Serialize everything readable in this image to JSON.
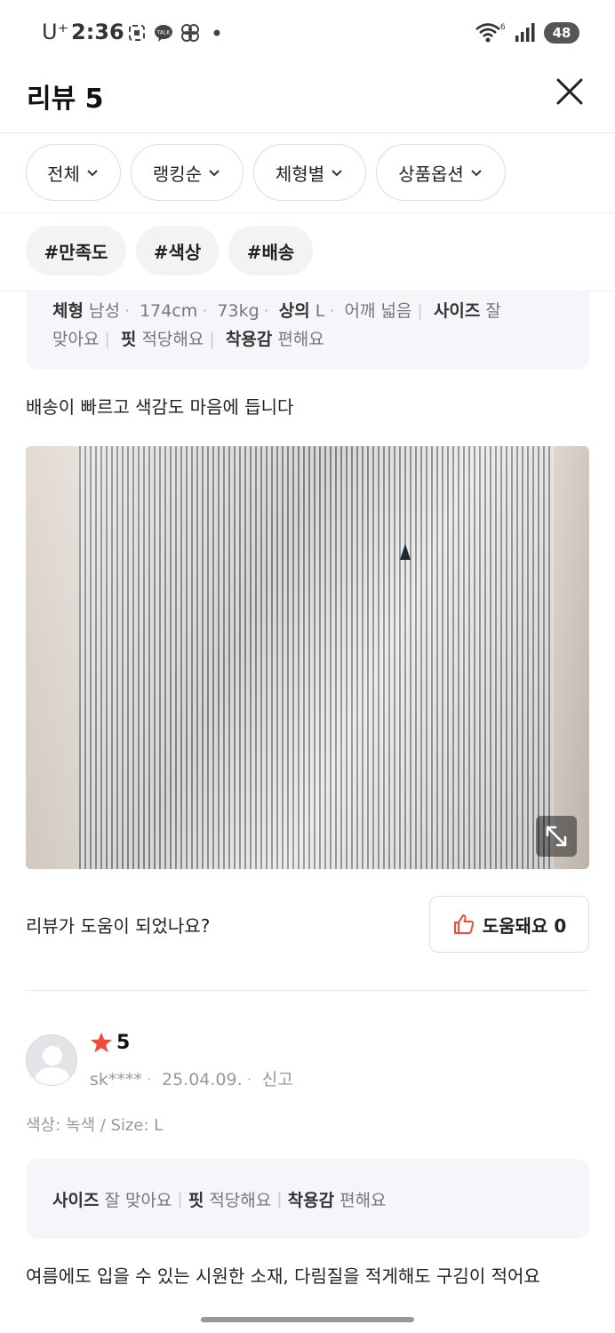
{
  "status_bar": {
    "carrier": "U⁺",
    "time": "2:36",
    "talk_badge": "TALK",
    "wifi_label": "6",
    "battery": "48"
  },
  "header": {
    "title": "리뷰 5"
  },
  "filters": [
    {
      "label": "전체"
    },
    {
      "label": "랭킹순"
    },
    {
      "label": "체형별"
    },
    {
      "label": "상품옵션"
    }
  ],
  "tags": [
    {
      "label": "#만족도"
    },
    {
      "label": "#색상"
    },
    {
      "label": "#배송"
    }
  ],
  "review1": {
    "body_type_label": "체형",
    "gender": "남성",
    "height": "174cm",
    "weight": "73kg",
    "top_label": "상의",
    "top_size": "L",
    "shoulder": "어깨 넓음",
    "size_label": "사이즈",
    "size_value_a": "잘",
    "size_value_b": "맞아요",
    "fit_label": "핏",
    "fit_value": "적당해요",
    "wear_label": "착용감",
    "wear_value": "편해요",
    "text": "배송이 빠르고 색감도 마음에 듭니다",
    "helpful_question": "리뷰가 도움이 되었나요?",
    "helpful_button": "도움돼요 0"
  },
  "review2": {
    "rating": "5",
    "user": "sk****",
    "date": "25.04.09.",
    "report": "신고",
    "option": "색상: 녹색 / Size: L",
    "size_label": "사이즈",
    "size_value": "잘 맞아요",
    "fit_label": "핏",
    "fit_value": "적당해요",
    "wear_label": "착용감",
    "wear_value": "편해요",
    "text": "여름에도 입을 수 있는 시원한 소재, 다림질을 적게해도 구김이 적어요"
  },
  "colors": {
    "accent_red": "#f04a3a",
    "star": "#f04a3a"
  }
}
